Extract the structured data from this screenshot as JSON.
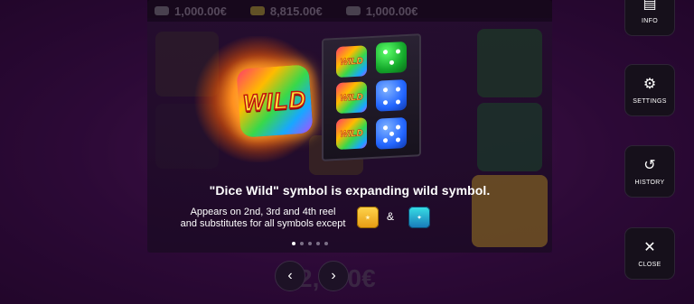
{
  "topbar": {
    "values": [
      "1,000.00€",
      "8,815.00€",
      "1,000.00€"
    ]
  },
  "rules_page": {
    "title": "\"Dice Wild\" symbol is expanding wild symbol.",
    "desc_line1": "Appears on 2nd, 3rd and 4th reel",
    "desc_line2": "and substitutes for all symbols except",
    "ampersand": "&",
    "wild_label": "WILD",
    "except_symbols": [
      "bonus-symbol",
      "scatter-symbol"
    ],
    "pagination": {
      "total": 5,
      "current": 1
    }
  },
  "nav": {
    "prev_icon": "‹",
    "next_icon": "›"
  },
  "background_win": "2,000€",
  "side_menu": {
    "info": {
      "label": "INFO",
      "icon": "info-icon"
    },
    "settings": {
      "label": "SETTINGS",
      "icon": "gear-icon"
    },
    "history": {
      "label": "HISTORY",
      "icon": "history-icon"
    },
    "close": {
      "label": "CLOSE",
      "icon": "close-icon"
    }
  },
  "colors": {
    "accent_orange": "#ff8a1c",
    "bonus_gold": "#ffd54d",
    "scatter_teal": "#38e1e6"
  }
}
